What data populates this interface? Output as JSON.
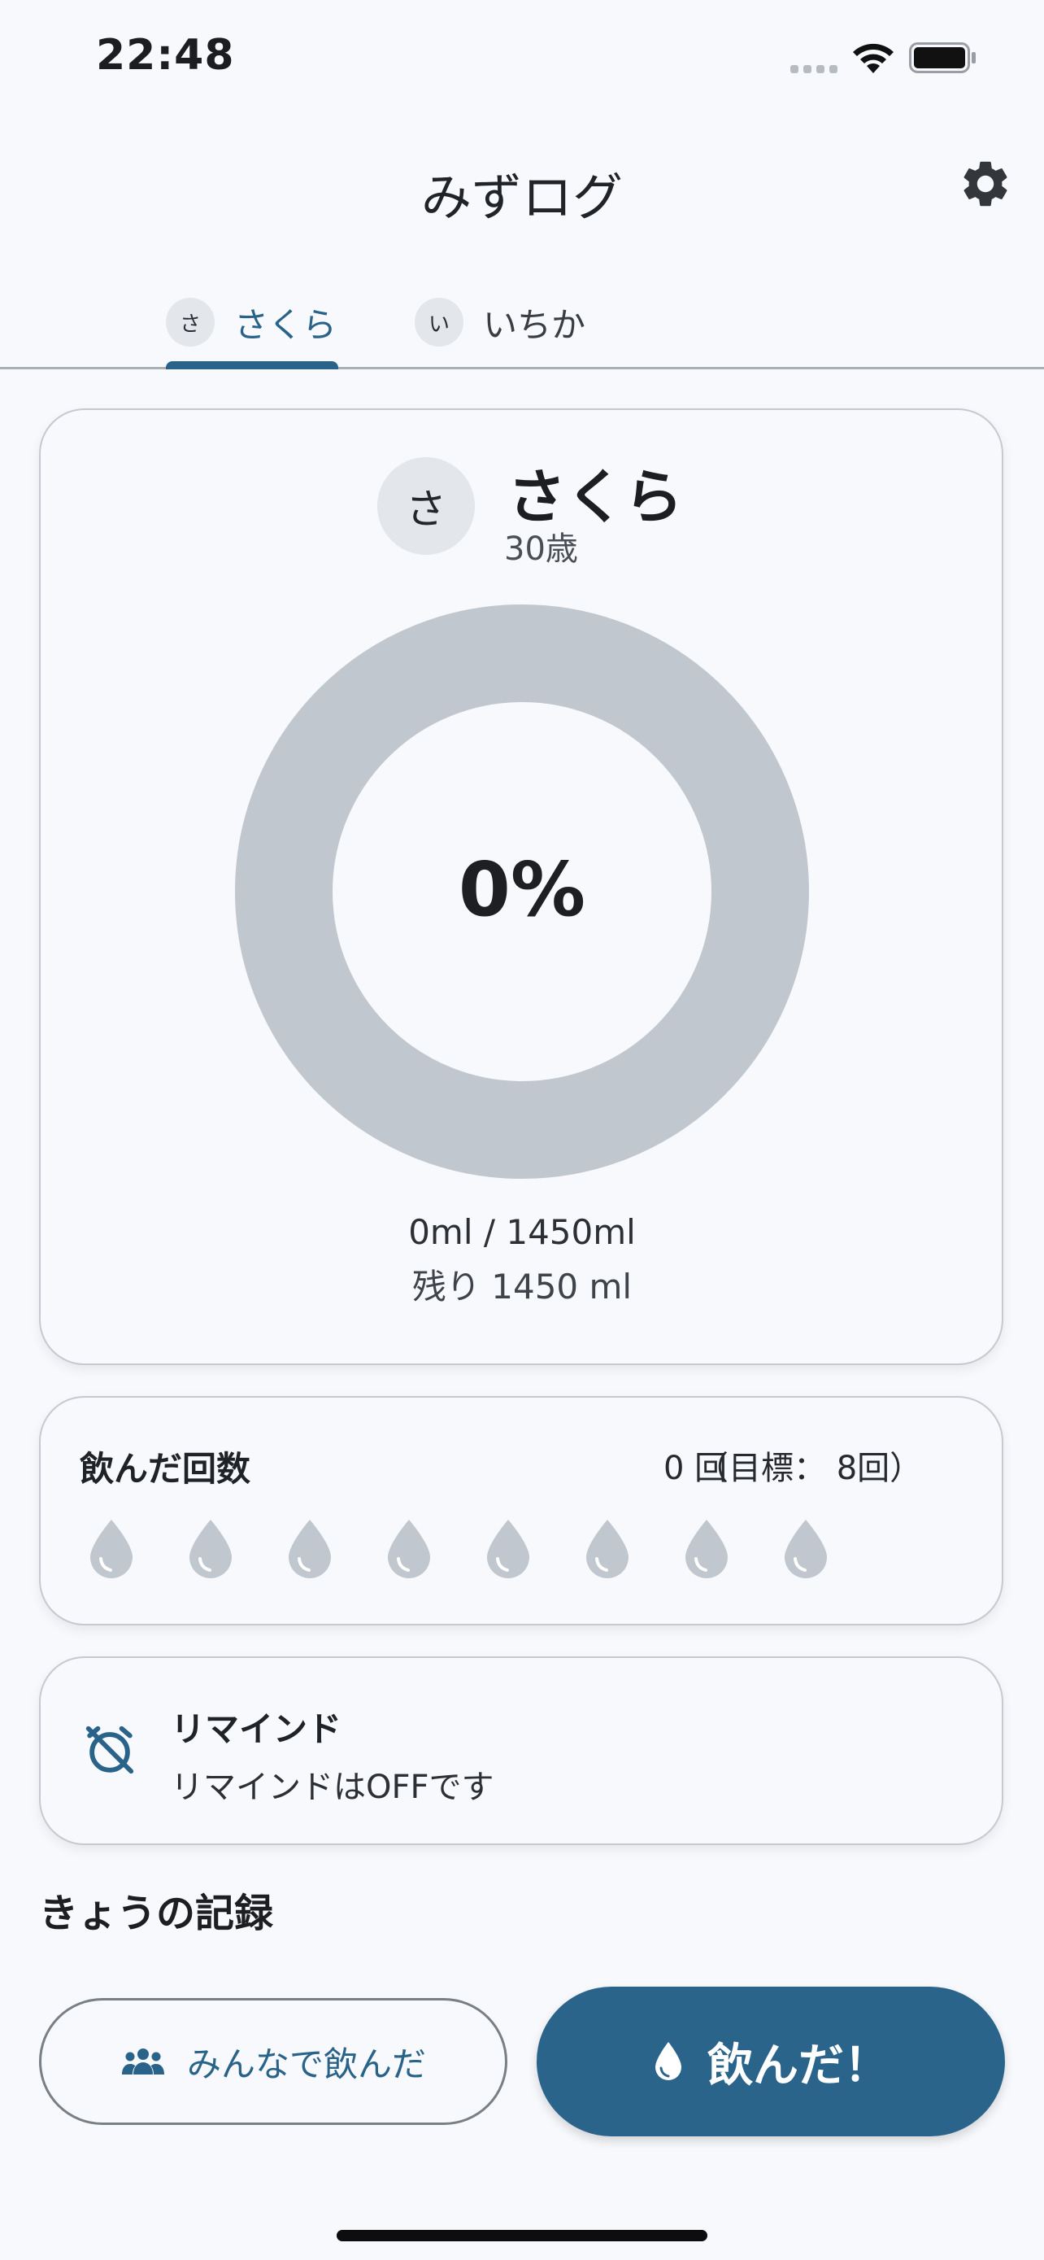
{
  "status_bar": {
    "time": "22:48"
  },
  "header": {
    "title": "みずログ"
  },
  "tabs": [
    {
      "avatar": "さ",
      "label": "さくら",
      "selected": true
    },
    {
      "avatar": "い",
      "label": "いちか",
      "selected": false
    }
  ],
  "profile": {
    "avatar": "さ",
    "name": "さくら",
    "age": "30歳"
  },
  "progress": {
    "percent_text": "0%",
    "fraction": 0,
    "amount_text": "0ml / 1450ml",
    "remaining_text": "残り 1450 ml"
  },
  "drink_count": {
    "title": "飲んだ回数",
    "value_text": "0 回",
    "target_text": "（目標： 8回）",
    "target": 8,
    "done": 0
  },
  "reminder": {
    "title": "リマインド",
    "status": "リマインドはOFFです"
  },
  "today_section": {
    "title": "きょうの記録"
  },
  "actions": {
    "drink_all_label": "みんなで飲んだ",
    "drink_label": "飲んだ！"
  },
  "colors": {
    "accent": "#2a6389",
    "ring_track": "#c1c7ce",
    "drop": "#c1c7ce",
    "background": "#f7f9fc"
  },
  "icons": {
    "settings": "gear-icon",
    "reminder": "alarm-off-icon",
    "group": "group-icon",
    "drop": "water-drop-icon"
  }
}
